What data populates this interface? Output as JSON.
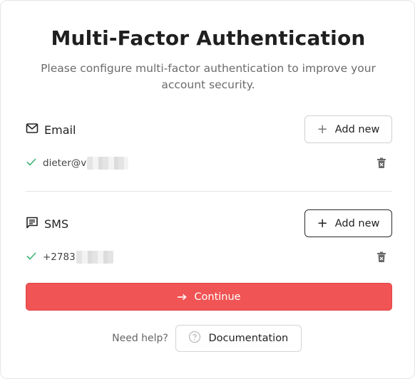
{
  "title": "Multi-Factor Authentication",
  "subtitle": "Please configure multi-factor authentication to improve your account security.",
  "email_section": {
    "label": "Email",
    "icon": "mail-icon",
    "add_label": "Add new",
    "entries": [
      {
        "value": "dieter@v",
        "status_icon": "check-icon",
        "action_icon": "trash-icon"
      }
    ]
  },
  "sms_section": {
    "label": "SMS",
    "icon": "message-icon",
    "add_label": "Add new",
    "entries": [
      {
        "value": "+2783",
        "status_icon": "check-icon",
        "action_icon": "trash-icon"
      }
    ]
  },
  "continue_label": "Continue",
  "help": {
    "text": "Need help?",
    "doc_label": "Documentation",
    "doc_icon": "help-circle-icon"
  },
  "colors": {
    "primary": "#f15454",
    "check": "#3cb371",
    "text": "#1f1f1f",
    "muted": "#6b6b6b"
  }
}
